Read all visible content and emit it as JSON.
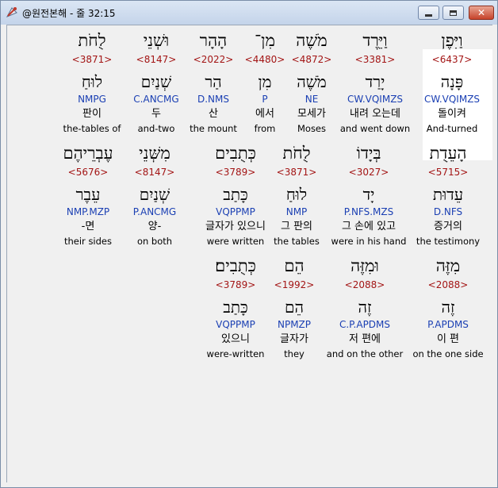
{
  "window": {
    "title": "@원전본해 - 줄 32:15",
    "buttons": {
      "minimize": "minimize",
      "maximize": "maximize",
      "close": "✕"
    }
  },
  "lines": [
    {
      "words": [
        {
          "heb": "וַיִּפֶן",
          "strong": "<6437>",
          "lemma": "פָּנָה",
          "morph": "CW.VQIMZS",
          "kor": "돌이켜",
          "eng": "And-turned",
          "highlight": true
        },
        {
          "heb": "וַיֵּרֶד",
          "strong": "<3381>",
          "lemma": "יָרַד",
          "morph": "CW.VQIMZS",
          "kor": "내려 오는데",
          "eng": "and went down"
        },
        {
          "heb": "מֹשֶׁה",
          "strong": "<4872>",
          "lemma": "מֹשֶׁה",
          "morph": "NE",
          "kor": "모세가",
          "eng": "Moses"
        },
        {
          "heb": "מִן־",
          "strong": "<4480>",
          "lemma": "מִן",
          "morph": "P",
          "kor": "에서",
          "eng": "from"
        },
        {
          "heb": "הָהָר",
          "strong": "<2022>",
          "lemma": "הַר",
          "morph": "D.NMS",
          "kor": "산",
          "eng": "the mount"
        },
        {
          "heb": "וּשְׁנֵי",
          "strong": "<8147>",
          "lemma": "שְׁנַיִם",
          "morph": "C.ANCMG",
          "kor": "두",
          "eng": "and-two"
        },
        {
          "heb": "לֻחֹת",
          "strong": "<3871>",
          "lemma": "לוּחַ",
          "morph": "NMPG",
          "kor": "판이",
          "eng": "the-tables of"
        }
      ]
    },
    {
      "words": [
        {
          "heb": "הָעֵדֻת",
          "strong": "<5715>",
          "lemma": "עֵדוּת",
          "morph": "D.NFS",
          "kor": "증거의",
          "eng": "the testimony"
        },
        {
          "heb": "בְּיָדוֹ",
          "strong": "<3027>",
          "lemma": "יָד",
          "morph": "P.NFS.MZS",
          "kor": "그 손에 있고",
          "eng": "were in his hand"
        },
        {
          "heb": "לֻחֹת",
          "strong": "<3871>",
          "lemma": "לוּחַ",
          "morph": "NMP",
          "kor": "그 판의",
          "eng": "the tables"
        },
        {
          "heb": "כְּתֻבִים",
          "strong": "<3789>",
          "lemma": "כָּתַב",
          "morph": "VQPPMP",
          "kor": "글자가 있으니",
          "eng": "were written"
        },
        {
          "heb": "מִשְּׁנֵי",
          "strong": "<8147>",
          "lemma": "שְׁנַיִם",
          "morph": "P.ANCMG",
          "kor": "양-",
          "eng": "on both"
        },
        {
          "heb": "עֶבְרֵיהֶם",
          "strong": "<5676>",
          "lemma": "עֵבֶר",
          "morph": "NMP.MZP",
          "kor": "-면",
          "eng": "their sides"
        }
      ]
    },
    {
      "words": [
        {
          "heb": "מִזֶּה",
          "strong": "<2088>",
          "lemma": "זֶה",
          "morph": "P.APDMS",
          "kor": "이 편",
          "eng": "on the one side"
        },
        {
          "heb": "וּמִזֶּה",
          "strong": "<2088>",
          "lemma": "זֶה",
          "morph": "C.P.APDMS",
          "kor": "저 편에",
          "eng": "and on the other"
        },
        {
          "heb": "הֵם",
          "strong": "<1992>",
          "lemma": "הֵם",
          "morph": "NPMZP",
          "kor": "글자가",
          "eng": "they"
        },
        {
          "heb": "כְּתֻבִים׃",
          "strong": "<3789>",
          "lemma": "כָּתַב",
          "morph": "VQPPMP",
          "kor": "있으니",
          "eng": "were-written"
        }
      ]
    }
  ]
}
